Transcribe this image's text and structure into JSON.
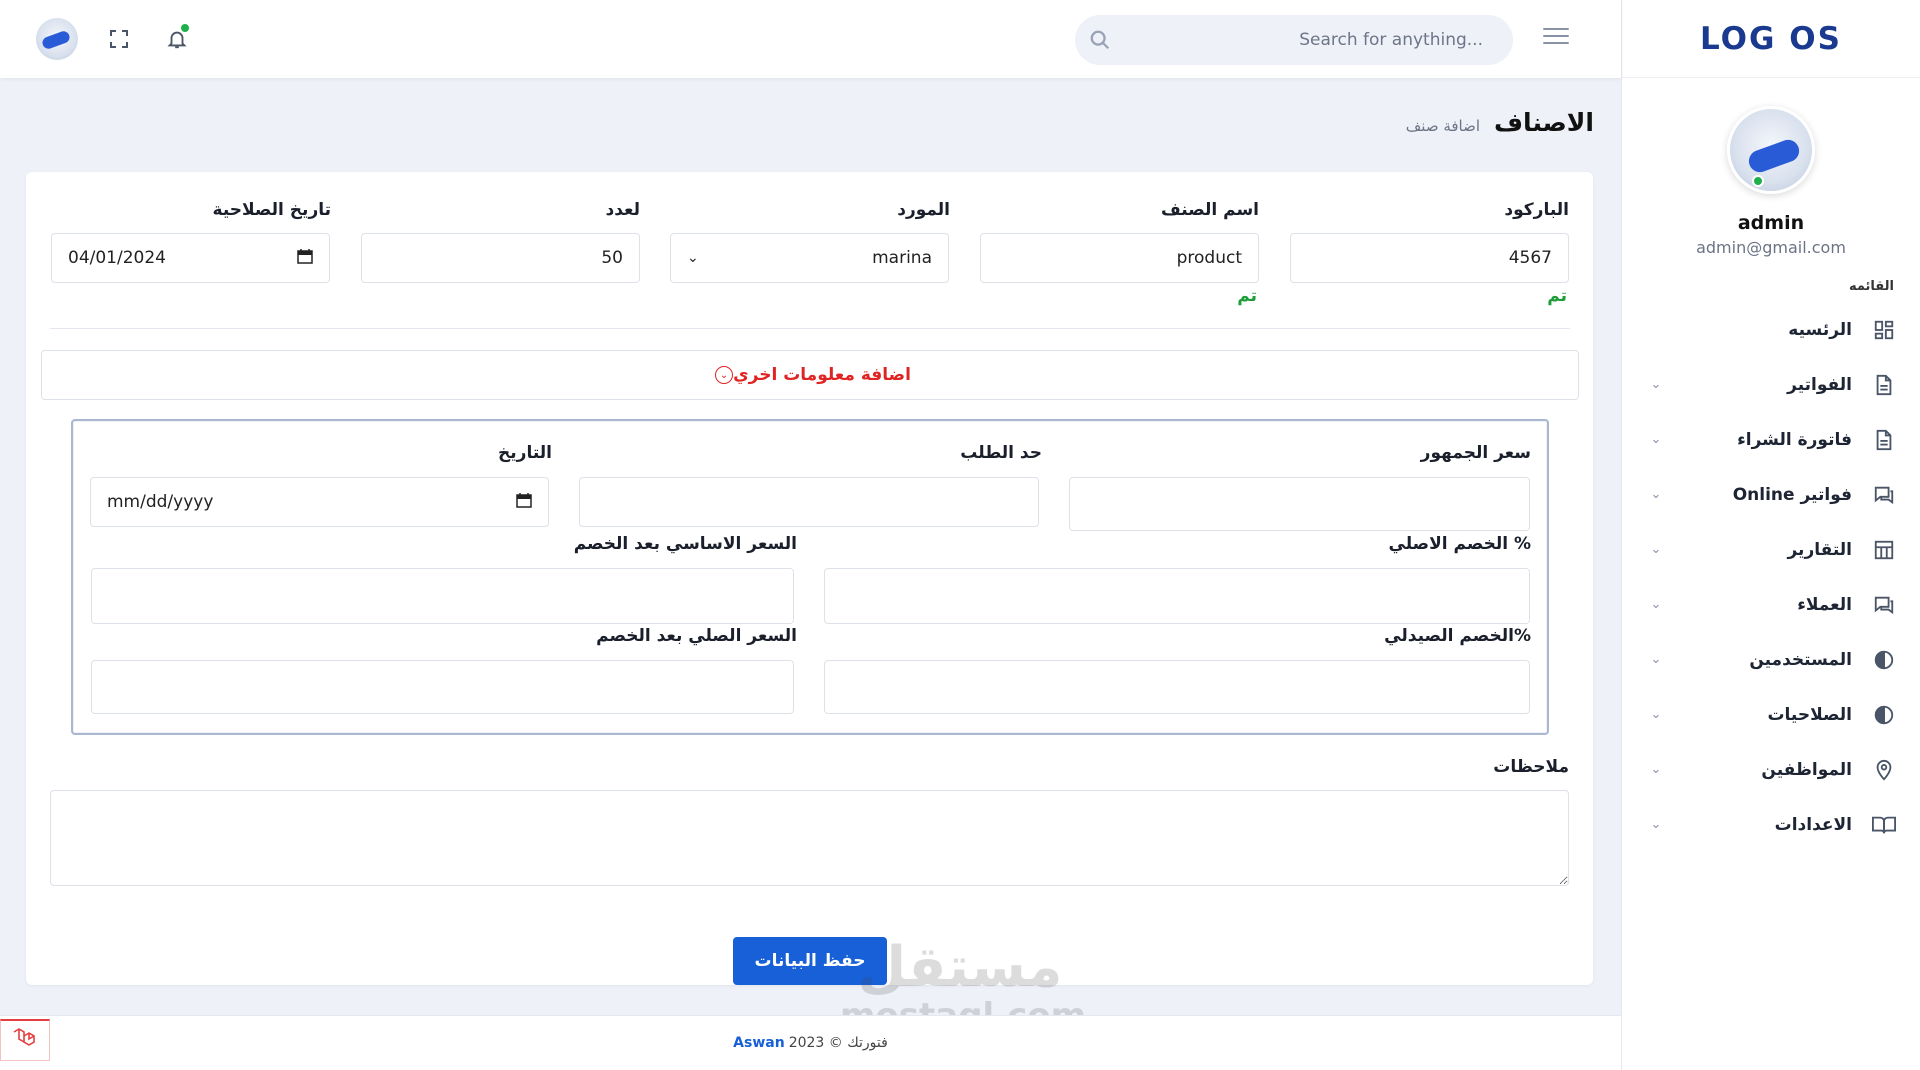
{
  "brand": {
    "logo": "LOG OS"
  },
  "topbar": {
    "search_placeholder": "...Search for anything"
  },
  "user": {
    "name": "admin",
    "email": "admin@gmail.com"
  },
  "sidebar": {
    "menu_title": "القائمه",
    "items": [
      {
        "label": "الرئسيه",
        "icon": "dashboard-icon",
        "has_chevron": false
      },
      {
        "label": "الفواتير",
        "icon": "document-icon",
        "has_chevron": true
      },
      {
        "label": "فاتورة الشراء",
        "icon": "document-icon",
        "has_chevron": true
      },
      {
        "label": "فواتير Online",
        "icon": "chat-icon",
        "has_chevron": true
      },
      {
        "label": "التقارير",
        "icon": "table-icon",
        "has_chevron": true
      },
      {
        "label": "العملاء",
        "icon": "chat-icon",
        "has_chevron": true
      },
      {
        "label": "المستخدمين",
        "icon": "half-circle-icon",
        "has_chevron": true
      },
      {
        "label": "الصلاحيات",
        "icon": "half-circle-icon",
        "has_chevron": true
      },
      {
        "label": "المواظفين",
        "icon": "map-pin-icon",
        "has_chevron": true
      },
      {
        "label": "الاعدادات",
        "icon": "book-icon",
        "has_chevron": true
      }
    ]
  },
  "page": {
    "title": "الاصناف",
    "breadcrumb": "اضافة صنف"
  },
  "form": {
    "barcode": {
      "label": "الباركود",
      "value": "4567",
      "status": "تم"
    },
    "item_name": {
      "label": "اسم الصنف",
      "value": "product",
      "status": "تم"
    },
    "supplier": {
      "label": "المورد",
      "value": "marina"
    },
    "quantity": {
      "label": "لعدد",
      "value": "50"
    },
    "expiry": {
      "label": "تاريخ الصلاحية",
      "value": "04/01/2024"
    },
    "more_info": "اضافة معلومات اخري",
    "retail_price": {
      "label": "سعر الجمهور",
      "value": ""
    },
    "reorder_limit": {
      "label": "حد الطلب",
      "value": ""
    },
    "date": {
      "label": "التاريخ",
      "placeholder": "mm/dd/yyyy"
    },
    "original_discount": {
      "label": "الخصم الاصلي %",
      "value": ""
    },
    "base_price_after_discount": {
      "label": "السعر الاساسي بعد الخصم",
      "value": ""
    },
    "pharmacist_discount": {
      "label": "الخصم الصيدلي%",
      "value": ""
    },
    "original_price_after_discount": {
      "label": "السعر الصلي بعد الخصم",
      "value": ""
    },
    "notes": {
      "label": "ملاحظات",
      "value": ""
    },
    "save_label": "حفظ البيانات"
  },
  "footer": {
    "text": "فتورتك © 2023",
    "brand": "Aswan"
  },
  "watermark": {
    "arabic": "مستقل",
    "latin": "mostaql.com"
  },
  "colors": {
    "primary": "#1760d7",
    "logo": "#1a3a8f",
    "success": "#1f9d3a",
    "danger": "#e02424",
    "online": "#20b04b"
  }
}
